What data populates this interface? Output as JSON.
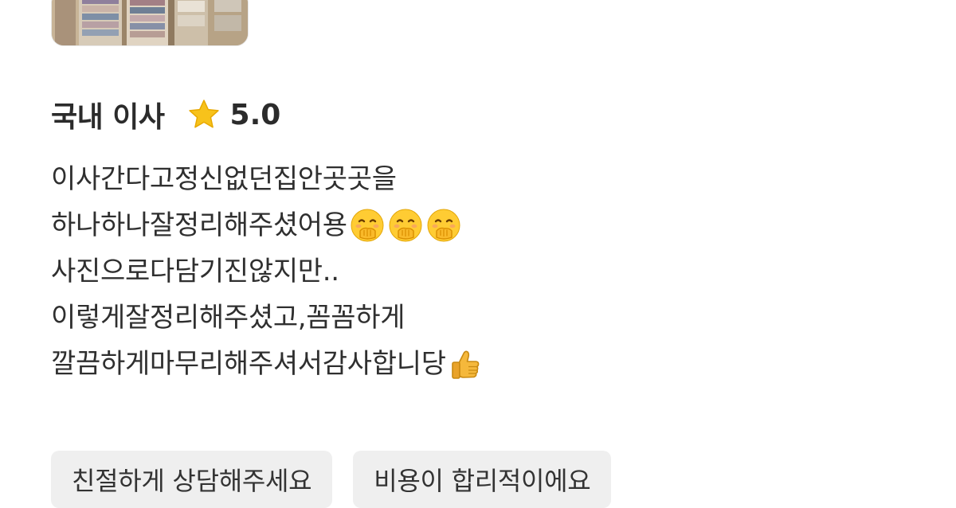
{
  "review": {
    "category": "국내 이사",
    "rating": "5.0",
    "rating_icon": "star-icon",
    "lines": [
      {
        "text": "이사간다고정신없던집안곳곳을",
        "emojis": []
      },
      {
        "text": "하나하나잘정리해주셨어용",
        "emojis": [
          "hand-over-mouth-emoji",
          "hand-over-mouth-emoji",
          "hand-over-mouth-emoji"
        ]
      },
      {
        "text": "사진으로다담기진않지만..",
        "emojis": []
      },
      {
        "text": "이렇게잘정리해주셨고,꼼꼼하게",
        "emojis": []
      },
      {
        "text": "깔끔하게마무리해주셔서감사합니당",
        "emojis": [
          "thumbs-up-emoji"
        ]
      }
    ]
  },
  "tags": [
    {
      "label": "친절하게 상담해주세요"
    },
    {
      "label": "비용이 합리적이에요"
    }
  ],
  "colors": {
    "star": "#F7C21B",
    "tag_background": "#EFEFEF",
    "text": "#2F2F2F"
  }
}
